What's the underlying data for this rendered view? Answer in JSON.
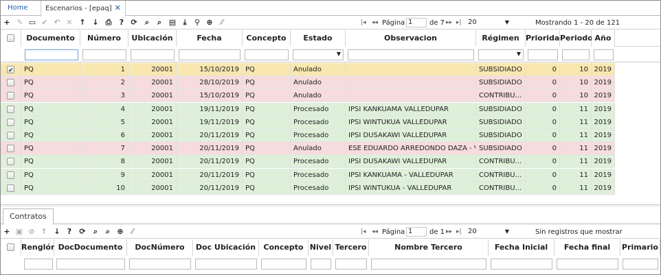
{
  "tabs": {
    "home": "Home",
    "active": "Escenarios - [epaq]",
    "close": "✕"
  },
  "toolbar": {
    "icons": [
      "add-icon",
      "edit-icon",
      "view-icon",
      "save-icon",
      "undo-icon",
      "delete-icon",
      "move-up-icon",
      "move-down-icon",
      "print-icon",
      "help-icon",
      "refresh-icon",
      "search-icon",
      "search-advanced-icon",
      "comment-icon",
      "download-icon",
      "pin-icon",
      "plus-circle-icon",
      "resize-icon"
    ],
    "page_label": "Página",
    "page_value": "1",
    "page_of": "de 7",
    "page_size": "20",
    "status": "Mostrando 1 - 20 de 121"
  },
  "grid": {
    "columns": [
      "Documento",
      "Número",
      "Ubicación",
      "Fecha",
      "Concepto",
      "Estado",
      "Observacion",
      "Régimen",
      "Prioridad",
      "Periodo",
      "Año"
    ],
    "row_colors": {
      "yellow": "#f9e7b0",
      "red": "#f6dcdc",
      "green": "#dff0da"
    },
    "rows": [
      {
        "doc": "PQ",
        "num": "1",
        "ubi": "20001",
        "fecha": "15/10/2019",
        "concepto": "PQ",
        "estado": "Anulado",
        "obs": "",
        "regimen": "SUBSIDIADO",
        "prioridad": "0",
        "periodo": "10",
        "anio": "2019",
        "color": "yellow",
        "checked": true
      },
      {
        "doc": "PQ",
        "num": "2",
        "ubi": "20001",
        "fecha": "28/10/2019",
        "concepto": "PQ",
        "estado": "Anulado",
        "obs": "",
        "regimen": "SUBSIDIADO",
        "prioridad": "0",
        "periodo": "10",
        "anio": "2019",
        "color": "red",
        "checked": false
      },
      {
        "doc": "PQ",
        "num": "3",
        "ubi": "20001",
        "fecha": "15/10/2019",
        "concepto": "PQ",
        "estado": "Anulado",
        "obs": "",
        "regimen": "CONTRIBU...",
        "prioridad": "0",
        "periodo": "10",
        "anio": "2019",
        "color": "red",
        "checked": false
      },
      {
        "doc": "PQ",
        "num": "4",
        "ubi": "20001",
        "fecha": "19/11/2019",
        "concepto": "PQ",
        "estado": "Procesado",
        "obs": "IPSI KANKUAMA VALLEDUPAR",
        "regimen": "SUBSIDIADO",
        "prioridad": "0",
        "periodo": "11",
        "anio": "2019",
        "color": "green",
        "checked": false
      },
      {
        "doc": "PQ",
        "num": "5",
        "ubi": "20001",
        "fecha": "19/11/2019",
        "concepto": "PQ",
        "estado": "Procesado",
        "obs": "IPSI WINTUKUA VALLEDUPAR",
        "regimen": "SUBSIDIADO",
        "prioridad": "0",
        "periodo": "11",
        "anio": "2019",
        "color": "green",
        "checked": false
      },
      {
        "doc": "PQ",
        "num": "6",
        "ubi": "20001",
        "fecha": "20/11/2019",
        "concepto": "PQ",
        "estado": "Procesado",
        "obs": "IPSI DUSAKAWI VALLEDUPAR",
        "regimen": "SUBSIDIADO",
        "prioridad": "0",
        "periodo": "11",
        "anio": "2019",
        "color": "green",
        "checked": false
      },
      {
        "doc": "PQ",
        "num": "7",
        "ubi": "20001",
        "fecha": "20/11/2019",
        "concepto": "PQ",
        "estado": "Anulado",
        "obs": "ESE EDUARDO ARREDONDO DAZA - V...",
        "regimen": "SUBSIDIADO",
        "prioridad": "0",
        "periodo": "11",
        "anio": "2019",
        "color": "red",
        "checked": false
      },
      {
        "doc": "PQ",
        "num": "8",
        "ubi": "20001",
        "fecha": "20/11/2019",
        "concepto": "PQ",
        "estado": "Procesado",
        "obs": "IPSI DUSAKAWI VALLEDUPAR",
        "regimen": "CONTRIBU...",
        "prioridad": "0",
        "periodo": "11",
        "anio": "2019",
        "color": "green",
        "checked": false
      },
      {
        "doc": "PQ",
        "num": "9",
        "ubi": "20001",
        "fecha": "20/11/2019",
        "concepto": "PQ",
        "estado": "Procesado",
        "obs": "IPSI KANKUAMA - VALLEDUPAR",
        "regimen": "CONTRIBU...",
        "prioridad": "0",
        "periodo": "11",
        "anio": "2019",
        "color": "green",
        "checked": false
      },
      {
        "doc": "PQ",
        "num": "10",
        "ubi": "20001",
        "fecha": "20/11/2019",
        "concepto": "PQ",
        "estado": "Procesado",
        "obs": "IPSI WINTUKUA - VALLEDUPAR",
        "regimen": "CONTRIBU...",
        "prioridad": "0",
        "periodo": "11",
        "anio": "2019",
        "color": "green",
        "checked": false
      }
    ]
  },
  "contratos": {
    "tab": "Contratos",
    "toolbar": {
      "page_label": "Página",
      "page_value": "1",
      "page_of": "de 1",
      "page_size": "20",
      "status": "Sin registros que mostrar"
    },
    "columns": [
      "Renglón",
      "DocDocumento",
      "DocNúmero",
      "Doc Ubicación",
      "Concepto",
      "Nivel",
      "Tercero",
      "Nombre Tercero",
      "Fecha Inicial",
      "Fecha final",
      "Primario"
    ]
  }
}
